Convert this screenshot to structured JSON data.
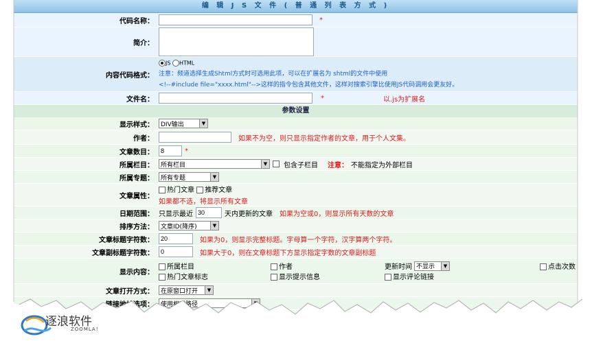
{
  "title": "编 辑 J S 文 件 ( 普 通 列 表 方 式 )",
  "fields": {
    "code_name": {
      "label": "代码名称：",
      "star": "*"
    },
    "intro": {
      "label": "简介："
    },
    "content_format": {
      "label": "内容代码格式：",
      "opt_js": "JS",
      "opt_html": "HTML",
      "note_prefix": "注意：",
      "note1": "频道选择生成Shtml方式时可选用此项，可以在扩展名为 shtml的文件中使用",
      "note2": "<!--#include file=\"xxxx.html\"-->这样的指令包含其他文件，这样对搜索引擎比使用JS代码调用会更友好。"
    },
    "file_name": {
      "label": "文件名：",
      "star": "*",
      "hint": "以.js为扩展名"
    }
  },
  "section_params": "参数设置",
  "params": {
    "display_style": {
      "label": "显示样式：",
      "value": "DIV输出"
    },
    "author": {
      "label": "作者：",
      "hint": "如果不为空，则只显示指定作者的文章，用于个人文集。"
    },
    "article_count": {
      "label": "文章数目：",
      "value": "8",
      "star": "*"
    },
    "column": {
      "label": "所属栏目：",
      "value": "所有栏目",
      "cb_label": "包含子栏目",
      "note_prefix": "注意：",
      "note": "不能指定为外部栏目"
    },
    "topic": {
      "label": "所属专题：",
      "value": "所有专题"
    },
    "attributes": {
      "label": "文章属性：",
      "cb1": "热门文章",
      "cb2": "推荐文章",
      "hint": "如果都不选，将显示所有文章"
    },
    "date_range": {
      "label": "日期范围：",
      "prefix": "只显示最近",
      "value": "30",
      "suffix": "天内更新的文章",
      "hint": "如果为空或0，则显示所有天数的文章"
    },
    "sort": {
      "label": "排序方法：",
      "value": "文章ID(降序)"
    },
    "title_chars": {
      "label": "文章标题字符数：",
      "value": "20",
      "hint": "如果为0，则显示完整标题。字母算一个字符，汉字算两个字符。"
    },
    "subtitle_chars": {
      "label": "文章副标题字符数：",
      "value": "0",
      "hint": "如果大于0，则在文章标题下方显示指定字数的文章副标题"
    },
    "show_content": {
      "label": "显示内容：",
      "cb_column": "所属栏目",
      "cb_author": "作者",
      "update_time_label": "更新时间",
      "update_time_value": "不显示",
      "cb_hits": "点击次数",
      "cb_hot_mark": "热门文章标志",
      "cb_tip": "显示提示信息",
      "cb_comment": "显示评论链接"
    },
    "open_mode": {
      "label": "文章打开方式：",
      "value": "在原窗口打开"
    },
    "link_option": {
      "label": "链接地址选项：",
      "value": "使用相对路径"
    }
  },
  "watermark": {
    "name": "逐浪软件",
    "sub": "ZOOMLA!"
  }
}
